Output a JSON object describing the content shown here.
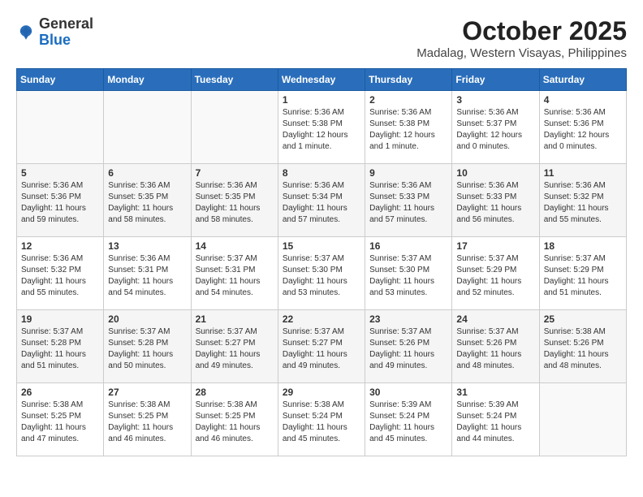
{
  "header": {
    "logo_general": "General",
    "logo_blue": "Blue",
    "month_title": "October 2025",
    "location": "Madalag, Western Visayas, Philippines"
  },
  "weekdays": [
    "Sunday",
    "Monday",
    "Tuesday",
    "Wednesday",
    "Thursday",
    "Friday",
    "Saturday"
  ],
  "weeks": [
    [
      {
        "day": "",
        "info": ""
      },
      {
        "day": "",
        "info": ""
      },
      {
        "day": "",
        "info": ""
      },
      {
        "day": "1",
        "info": "Sunrise: 5:36 AM\nSunset: 5:38 PM\nDaylight: 12 hours\nand 1 minute."
      },
      {
        "day": "2",
        "info": "Sunrise: 5:36 AM\nSunset: 5:38 PM\nDaylight: 12 hours\nand 1 minute."
      },
      {
        "day": "3",
        "info": "Sunrise: 5:36 AM\nSunset: 5:37 PM\nDaylight: 12 hours\nand 0 minutes."
      },
      {
        "day": "4",
        "info": "Sunrise: 5:36 AM\nSunset: 5:36 PM\nDaylight: 12 hours\nand 0 minutes."
      }
    ],
    [
      {
        "day": "5",
        "info": "Sunrise: 5:36 AM\nSunset: 5:36 PM\nDaylight: 11 hours\nand 59 minutes."
      },
      {
        "day": "6",
        "info": "Sunrise: 5:36 AM\nSunset: 5:35 PM\nDaylight: 11 hours\nand 58 minutes."
      },
      {
        "day": "7",
        "info": "Sunrise: 5:36 AM\nSunset: 5:35 PM\nDaylight: 11 hours\nand 58 minutes."
      },
      {
        "day": "8",
        "info": "Sunrise: 5:36 AM\nSunset: 5:34 PM\nDaylight: 11 hours\nand 57 minutes."
      },
      {
        "day": "9",
        "info": "Sunrise: 5:36 AM\nSunset: 5:33 PM\nDaylight: 11 hours\nand 57 minutes."
      },
      {
        "day": "10",
        "info": "Sunrise: 5:36 AM\nSunset: 5:33 PM\nDaylight: 11 hours\nand 56 minutes."
      },
      {
        "day": "11",
        "info": "Sunrise: 5:36 AM\nSunset: 5:32 PM\nDaylight: 11 hours\nand 55 minutes."
      }
    ],
    [
      {
        "day": "12",
        "info": "Sunrise: 5:36 AM\nSunset: 5:32 PM\nDaylight: 11 hours\nand 55 minutes."
      },
      {
        "day": "13",
        "info": "Sunrise: 5:36 AM\nSunset: 5:31 PM\nDaylight: 11 hours\nand 54 minutes."
      },
      {
        "day": "14",
        "info": "Sunrise: 5:37 AM\nSunset: 5:31 PM\nDaylight: 11 hours\nand 54 minutes."
      },
      {
        "day": "15",
        "info": "Sunrise: 5:37 AM\nSunset: 5:30 PM\nDaylight: 11 hours\nand 53 minutes."
      },
      {
        "day": "16",
        "info": "Sunrise: 5:37 AM\nSunset: 5:30 PM\nDaylight: 11 hours\nand 53 minutes."
      },
      {
        "day": "17",
        "info": "Sunrise: 5:37 AM\nSunset: 5:29 PM\nDaylight: 11 hours\nand 52 minutes."
      },
      {
        "day": "18",
        "info": "Sunrise: 5:37 AM\nSunset: 5:29 PM\nDaylight: 11 hours\nand 51 minutes."
      }
    ],
    [
      {
        "day": "19",
        "info": "Sunrise: 5:37 AM\nSunset: 5:28 PM\nDaylight: 11 hours\nand 51 minutes."
      },
      {
        "day": "20",
        "info": "Sunrise: 5:37 AM\nSunset: 5:28 PM\nDaylight: 11 hours\nand 50 minutes."
      },
      {
        "day": "21",
        "info": "Sunrise: 5:37 AM\nSunset: 5:27 PM\nDaylight: 11 hours\nand 49 minutes."
      },
      {
        "day": "22",
        "info": "Sunrise: 5:37 AM\nSunset: 5:27 PM\nDaylight: 11 hours\nand 49 minutes."
      },
      {
        "day": "23",
        "info": "Sunrise: 5:37 AM\nSunset: 5:26 PM\nDaylight: 11 hours\nand 49 minutes."
      },
      {
        "day": "24",
        "info": "Sunrise: 5:37 AM\nSunset: 5:26 PM\nDaylight: 11 hours\nand 48 minutes."
      },
      {
        "day": "25",
        "info": "Sunrise: 5:38 AM\nSunset: 5:26 PM\nDaylight: 11 hours\nand 48 minutes."
      }
    ],
    [
      {
        "day": "26",
        "info": "Sunrise: 5:38 AM\nSunset: 5:25 PM\nDaylight: 11 hours\nand 47 minutes."
      },
      {
        "day": "27",
        "info": "Sunrise: 5:38 AM\nSunset: 5:25 PM\nDaylight: 11 hours\nand 46 minutes."
      },
      {
        "day": "28",
        "info": "Sunrise: 5:38 AM\nSunset: 5:25 PM\nDaylight: 11 hours\nand 46 minutes."
      },
      {
        "day": "29",
        "info": "Sunrise: 5:38 AM\nSunset: 5:24 PM\nDaylight: 11 hours\nand 45 minutes."
      },
      {
        "day": "30",
        "info": "Sunrise: 5:39 AM\nSunset: 5:24 PM\nDaylight: 11 hours\nand 45 minutes."
      },
      {
        "day": "31",
        "info": "Sunrise: 5:39 AM\nSunset: 5:24 PM\nDaylight: 11 hours\nand 44 minutes."
      },
      {
        "day": "",
        "info": ""
      }
    ]
  ]
}
